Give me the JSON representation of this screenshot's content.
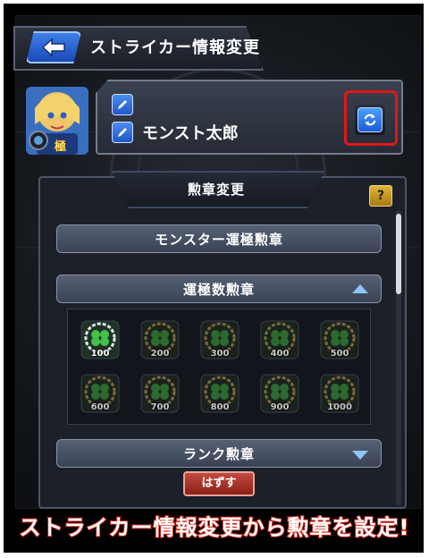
{
  "header": {
    "title": "ストライカー情報変更",
    "back_icon": "back-arrow-icon"
  },
  "profile": {
    "name_line_1": "",
    "name_line_2": "モンスト太郎",
    "avatar_badge": "極"
  },
  "medal_panel": {
    "title": "勲章変更",
    "help_label": "?",
    "sections": {
      "monster_luck": "モンスター運極勲章",
      "luck_count": "運極数勲章",
      "rank": "ランク勲章"
    },
    "medals": [
      {
        "label": "100",
        "unlocked": true
      },
      {
        "label": "200",
        "unlocked": false
      },
      {
        "label": "300",
        "unlocked": false
      },
      {
        "label": "400",
        "unlocked": false
      },
      {
        "label": "500",
        "unlocked": false
      },
      {
        "label": "600",
        "unlocked": false
      },
      {
        "label": "700",
        "unlocked": false
      },
      {
        "label": "800",
        "unlocked": false
      },
      {
        "label": "900",
        "unlocked": false
      },
      {
        "label": "1000",
        "unlocked": false
      }
    ],
    "remove_label": "はずす"
  },
  "caption": "ストライカー情報変更から勲章を設定!",
  "colors": {
    "highlight": "#e01818",
    "accent": "#1f58c8",
    "caption_stroke": "#d4281c"
  }
}
